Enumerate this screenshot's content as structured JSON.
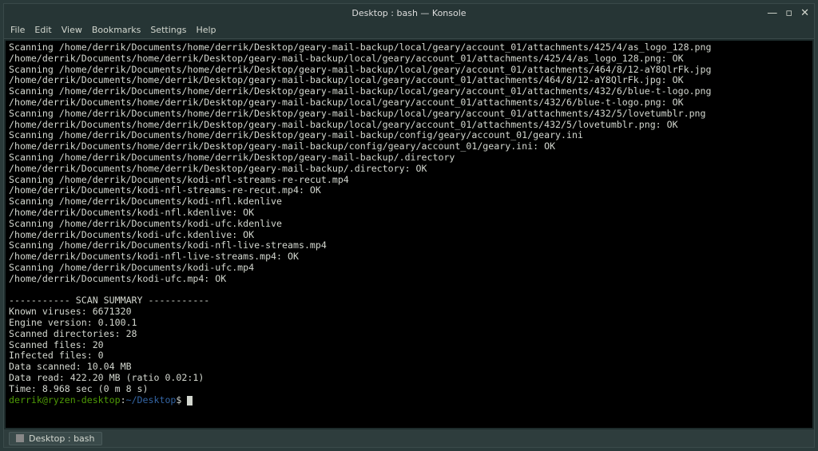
{
  "window": {
    "title": "Desktop : bash — Konsole",
    "controls": {
      "min": "—",
      "max": "▫",
      "close": "✕"
    }
  },
  "menubar": {
    "items": [
      "File",
      "Edit",
      "View",
      "Bookmarks",
      "Settings",
      "Help"
    ]
  },
  "terminal": {
    "lines": [
      "Scanning /home/derrik/Documents/home/derrik/Desktop/geary-mail-backup/local/geary/account_01/attachments/425/4/as_logo_128.png",
      "/home/derrik/Documents/home/derrik/Desktop/geary-mail-backup/local/geary/account_01/attachments/425/4/as_logo_128.png: OK",
      "Scanning /home/derrik/Documents/home/derrik/Desktop/geary-mail-backup/local/geary/account_01/attachments/464/8/12-aY8QlrFk.jpg",
      "/home/derrik/Documents/home/derrik/Desktop/geary-mail-backup/local/geary/account_01/attachments/464/8/12-aY8QlrFk.jpg: OK",
      "Scanning /home/derrik/Documents/home/derrik/Desktop/geary-mail-backup/local/geary/account_01/attachments/432/6/blue-t-logo.png",
      "/home/derrik/Documents/home/derrik/Desktop/geary-mail-backup/local/geary/account_01/attachments/432/6/blue-t-logo.png: OK",
      "Scanning /home/derrik/Documents/home/derrik/Desktop/geary-mail-backup/local/geary/account_01/attachments/432/5/lovetumblr.png",
      "/home/derrik/Documents/home/derrik/Desktop/geary-mail-backup/local/geary/account_01/attachments/432/5/lovetumblr.png: OK",
      "Scanning /home/derrik/Documents/home/derrik/Desktop/geary-mail-backup/config/geary/account_01/geary.ini",
      "/home/derrik/Documents/home/derrik/Desktop/geary-mail-backup/config/geary/account_01/geary.ini: OK",
      "Scanning /home/derrik/Documents/home/derrik/Desktop/geary-mail-backup/.directory",
      "/home/derrik/Documents/home/derrik/Desktop/geary-mail-backup/.directory: OK",
      "Scanning /home/derrik/Documents/kodi-nfl-streams-re-recut.mp4",
      "/home/derrik/Documents/kodi-nfl-streams-re-recut.mp4: OK",
      "Scanning /home/derrik/Documents/kodi-nfl.kdenlive",
      "/home/derrik/Documents/kodi-nfl.kdenlive: OK",
      "Scanning /home/derrik/Documents/kodi-ufc.kdenlive",
      "/home/derrik/Documents/kodi-ufc.kdenlive: OK",
      "Scanning /home/derrik/Documents/kodi-nfl-live-streams.mp4",
      "/home/derrik/Documents/kodi-nfl-live-streams.mp4: OK",
      "Scanning /home/derrik/Documents/kodi-ufc.mp4",
      "/home/derrik/Documents/kodi-ufc.mp4: OK",
      "",
      "----------- SCAN SUMMARY -----------",
      "Known viruses: 6671320",
      "Engine version: 0.100.1",
      "Scanned directories: 28",
      "Scanned files: 20",
      "Infected files: 0",
      "Data scanned: 10.04 MB",
      "Data read: 422.20 MB (ratio 0.02:1)",
      "Time: 8.968 sec (0 m 8 s)"
    ],
    "prompt": {
      "user_host": "derrik@ryzen-desktop",
      "colon": ":",
      "path": "~/Desktop",
      "dollar": "$ "
    }
  },
  "tabbar": {
    "tab_label": "Desktop : bash"
  }
}
